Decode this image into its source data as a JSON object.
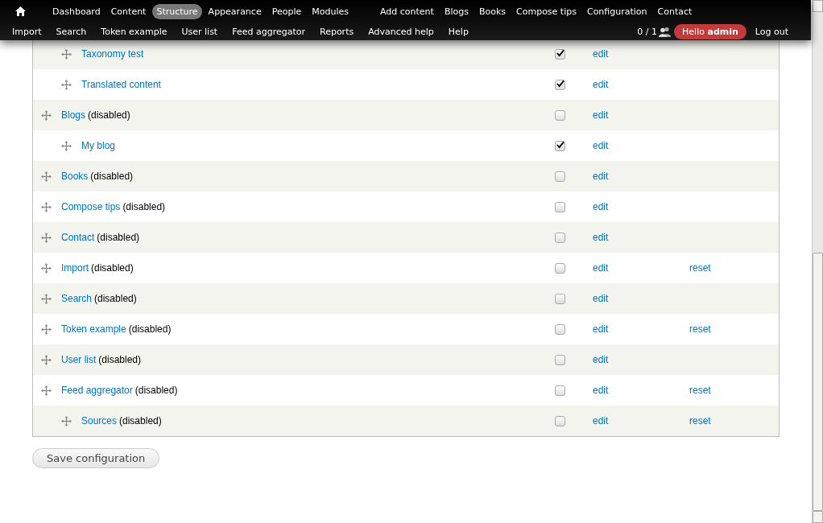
{
  "toolbar": {
    "menu": [
      {
        "label": "Dashboard",
        "selected": false
      },
      {
        "label": "Content",
        "selected": false
      },
      {
        "label": "Structure",
        "selected": true
      },
      {
        "label": "Appearance",
        "selected": false
      },
      {
        "label": "People",
        "selected": false
      },
      {
        "label": "Modules",
        "selected": false
      }
    ],
    "shortcuts_right": [
      "Add content",
      "Blogs",
      "Books",
      "Compose tips",
      "Configuration",
      "Contact"
    ],
    "shortcuts": [
      "Import",
      "Search",
      "Token example",
      "User list",
      "Feed aggregator",
      "Reports",
      "Advanced help",
      "Help"
    ],
    "user_count": "0 / 1",
    "greeting": "Hello **admin**",
    "logout": "Log out"
  },
  "links": [
    {
      "children": [
        {
          "title": "Taxonomy test",
          "enabled": true,
          "edit": "edit"
        },
        {
          "title": "Translated content",
          "enabled": true,
          "edit": "edit"
        }
      ]
    },
    {
      "title": "Blogs",
      "status": "(disabled)",
      "enabled": false,
      "edit": "edit",
      "children": [
        {
          "title": "My blog",
          "enabled": true,
          "edit": "edit"
        }
      ]
    },
    {
      "title": "Books",
      "status": "(disabled)",
      "enabled": false,
      "edit": "edit"
    },
    {
      "title": "Compose tips",
      "status": "(disabled)",
      "enabled": false,
      "edit": "edit"
    },
    {
      "title": "Contact",
      "status": "(disabled)",
      "enabled": false,
      "edit": "edit"
    },
    {
      "title": "Import",
      "status": "(disabled)",
      "enabled": false,
      "edit": "edit",
      "reset": "reset"
    },
    {
      "title": "Search",
      "status": "(disabled)",
      "enabled": false,
      "edit": "edit"
    },
    {
      "title": "Token example",
      "status": "(disabled)",
      "enabled": false,
      "edit": "edit",
      "reset": "reset"
    },
    {
      "title": "User list",
      "status": "(disabled)",
      "enabled": false,
      "edit": "edit"
    },
    {
      "title": "Feed aggregator",
      "status": "(disabled)",
      "enabled": false,
      "edit": "edit",
      "reset": "reset",
      "children": [
        {
          "title": "Sources",
          "status": "(disabled)",
          "enabled": false,
          "edit": "edit",
          "reset": "reset"
        }
      ]
    }
  ],
  "save_button": "Save configuration"
}
